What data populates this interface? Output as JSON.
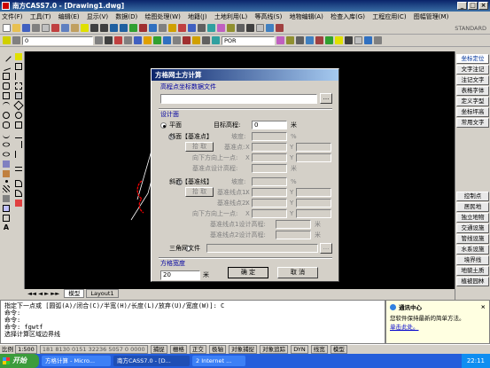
{
  "window": {
    "title": "南方CASS7.0 - [Drawing1.dwg]"
  },
  "menu": [
    "文件(F)",
    "工具(T)",
    "编辑(E)",
    "显示(V)",
    "数据(D)",
    "绘图处理(W)",
    "地籍(J)",
    "土地利用(L)",
    "等高线(S)",
    "地物编辑(A)",
    "检查入库(G)",
    "工程应用(C)",
    "图幅管理(M)"
  ],
  "toolbar": {
    "layer": "0",
    "layer2": "ByLayer",
    "standard": "STANDARD",
    "linetype": "POR"
  },
  "right_panel": {
    "top": [
      "坐标定位",
      "文字注记",
      "注记文字",
      "表格字体",
      "定义字型",
      "坐标坪高",
      "常用文字"
    ],
    "bottom": [
      "控制点",
      "居民地",
      "独立地物",
      "交通设施",
      "管线设施",
      "水系设施",
      "境界线",
      "地貌土质",
      "植被园林"
    ]
  },
  "tabs": {
    "model": "模型",
    "layout": "Layout1"
  },
  "command": {
    "lines": [
      "指定下一点或 [圆弧(A)/闭合(C)/半宽(H)/长度(L)/放弃(U)/宽度(W)]: C",
      "命令:",
      "命令:",
      "命令: fgwtf",
      "选择计算区域边界线"
    ]
  },
  "comm_center": {
    "title": "通讯中心",
    "body": "您软件保持最新的简单方法。",
    "link": "单击此处。"
  },
  "status": {
    "scale": "比例",
    "scale_value": "1:500",
    "coords": "181 8130 0151 32236 5057 0 0000",
    "buttons": [
      "捕捉",
      "栅格",
      "正交",
      "极轴",
      "对象捕捉",
      "对象追踪",
      "DYN",
      "线宽",
      "模型"
    ]
  },
  "taskbar": {
    "start": "开始",
    "tasks": [
      "方格计算 - Micro...",
      "南方CASS7.0 - [D...",
      "2 Internet ..."
    ],
    "clock": "22:11"
  },
  "dialog": {
    "title": "方格网土方计算",
    "file_group": "高程点坐标数据文件",
    "file_value": "",
    "browse": "...",
    "design_group": "设计面",
    "plane_label": "平面",
    "target_label": "目标高程:",
    "target_value": "0",
    "unit_m": "米",
    "slope_point_label": "斜面【基准点】",
    "pick_label": "拾 取",
    "slope_label": "坡度:",
    "percent": "%",
    "base_point_label": "基准点:",
    "x": "X",
    "y": "Y",
    "downward_label": "向下方向上一点:",
    "base_design_label": "基准点设计高程:",
    "slope_line_label": "斜面【基准线】",
    "line_pt1_label": "基准线点1:",
    "line_pt2_label": "基准线点2:",
    "line_pt1_design": "基准线点1设计高程:",
    "line_pt2_design": "基准线点2设计高程:",
    "triangle_label": "三角网文件",
    "grid_width_label": "方格宽度",
    "grid_width_value": "20",
    "ok": "确 定",
    "cancel": "取 消"
  },
  "colors": {
    "drawing_bg": "#000000",
    "boundary": "#ff0000",
    "title_blue": "#0a246a"
  }
}
